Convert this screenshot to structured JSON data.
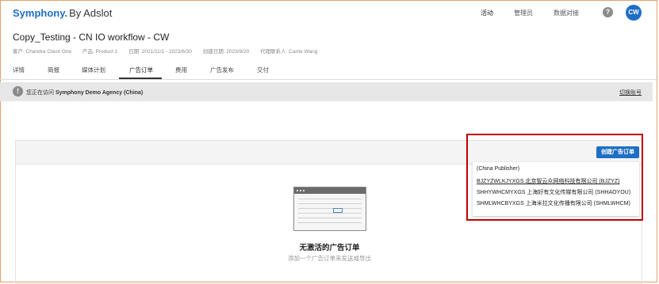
{
  "brand": {
    "name": "Symphony.",
    "suffix": "By Adslot"
  },
  "top_nav": [
    "活动",
    "管理员",
    "数据对接"
  ],
  "help_glyph": "?",
  "user_initials": "CW",
  "page_title": "Copy_Testing - CN IO workflow - CW",
  "meta": {
    "client": "客户: Chandra Client One",
    "product": "产品: Product 1",
    "dates": "日期: 2021/11/1 - 2023/6/30",
    "created": "创建日期: 2023/9/20",
    "agent": "代理联系人: Carrie Wang"
  },
  "tabs": [
    "详情",
    "简报",
    "媒体计划",
    "广告订单",
    "费用",
    "广告发布",
    "交付"
  ],
  "active_tab": "广告订单",
  "banner": {
    "prefix": "您正在访问",
    "agency": "Symphony Demo Agency (China)",
    "switch": "切换账号"
  },
  "create_button": "创建广告订单",
  "publishers": [
    "(China Publisher)",
    "BJZYZWLKJYXGS 北京智云众网络科技有限公司 (BJZYZ)",
    "SHHYWHCMYXGS 上海好有文化传媒有限公司 (SHHAOYOU)",
    "SHMLWHCBYXGS 上海米拉文化传播有限公司 (SHMLWHCM)"
  ],
  "empty_state": {
    "title": "无激活的广告订单",
    "subtitle": "添加一个广告订单来发送或导出"
  },
  "colors": {
    "brand": "#1e6fc4",
    "highlight": "#c00000"
  },
  "icons": [
    "help-icon",
    "alert-icon",
    "empty-orders-illustration"
  ]
}
